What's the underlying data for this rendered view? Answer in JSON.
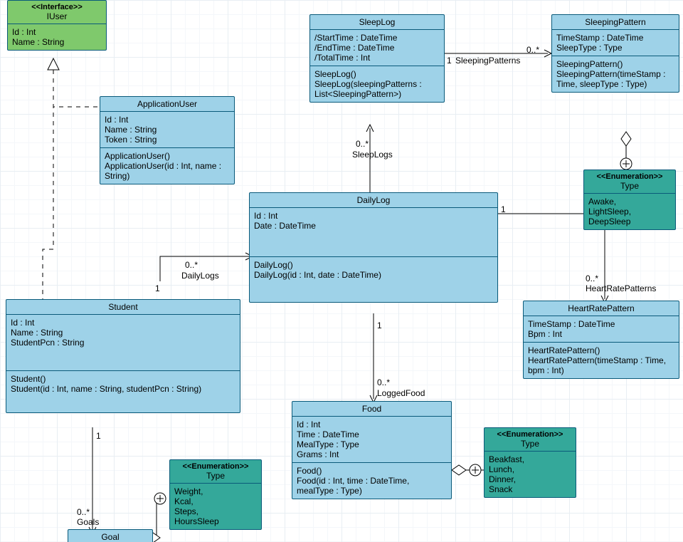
{
  "classes": {
    "IUser": {
      "stereo": "<<Interface>>",
      "name": "IUser",
      "attrs": [
        "Id : Int",
        "Name : String"
      ]
    },
    "ApplicationUser": {
      "name": "ApplicationUser",
      "attrs": [
        "Id : Int",
        "Name : String",
        "Token : String"
      ],
      "ops": [
        "ApplicationUser()",
        "ApplicationUser(id : Int, name : String)"
      ]
    },
    "SleepLog": {
      "name": "SleepLog",
      "attrs": [
        "/StartTime : DateTime",
        "/EndTime : DateTime",
        "/TotalTime : Int"
      ],
      "ops": [
        "SleepLog()",
        "SleepLog(sleepingPatterns : List<SleepingPattern>)"
      ]
    },
    "SleepingPattern": {
      "name": "SleepingPattern",
      "attrs": [
        "TimeStamp : DateTime",
        "SleepType : Type"
      ],
      "ops": [
        "SleepingPattern()",
        "SleepingPattern(timeStamp : Time, sleepType : Type)"
      ]
    },
    "EnumSleepType": {
      "stereo": "<<Enumeration>>",
      "name": "Type",
      "vals": [
        "Awake,",
        "LightSleep,",
        "DeepSleep"
      ]
    },
    "DailyLog": {
      "name": "DailyLog",
      "attrs": [
        "Id : Int",
        "Date : DateTime"
      ],
      "ops": [
        "DailyLog()",
        "DailyLog(id : Int, date : DateTime)"
      ]
    },
    "Student": {
      "name": "Student",
      "attrs": [
        "Id : Int",
        "Name : String",
        "StudentPcn : String"
      ],
      "ops": [
        "Student()",
        "Student(id : Int, name : String, studentPcn : String)"
      ]
    },
    "HeartRatePattern": {
      "name": "HeartRatePattern",
      "attrs": [
        "TimeStamp : DateTime",
        "Bpm : Int"
      ],
      "ops": [
        "HeartRatePattern()",
        "HeartRatePattern(timeStamp : Time, bpm : Int)"
      ]
    },
    "Food": {
      "name": "Food",
      "attrs": [
        "Id : Int",
        "Time : DateTime",
        "MealType : Type",
        "Grams : Int"
      ],
      "ops": [
        "Food()",
        "Food(id : Int, time : DateTime, mealType : Type)"
      ]
    },
    "EnumMealType": {
      "stereo": "<<Enumeration>>",
      "name": "Type",
      "vals": [
        "Beakfast,",
        "Lunch,",
        "Dinner,",
        "Snack"
      ]
    },
    "EnumGoalType": {
      "stereo": "<<Enumeration>>",
      "name": "Type",
      "vals": [
        "Weight,",
        "Kcal,",
        "Steps,",
        "HoursSleep"
      ]
    },
    "Goal": {
      "name": "Goal"
    }
  },
  "labels": {
    "sleepLogs": {
      "mult": "0..*",
      "role": "SleepLogs"
    },
    "sleepingPatterns": {
      "mult": "0..*",
      "one": "1",
      "role": "SleepingPatterns"
    },
    "dailyLogs": {
      "mult": "0..*",
      "one": "1",
      "role": "DailyLogs"
    },
    "heartRatePatterns": {
      "mult": "0..*",
      "one": "1",
      "role": "HeartRatePatterns"
    },
    "loggedFood": {
      "mult": "0..*",
      "one": "1",
      "role": "LoggedFood"
    },
    "goals": {
      "mult": "0..*",
      "one": "1",
      "role": "Goals"
    }
  }
}
